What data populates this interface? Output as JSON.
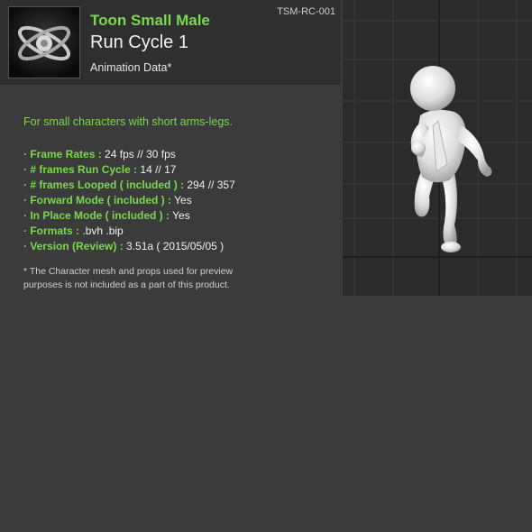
{
  "header": {
    "product_code": "TSM-RC-001",
    "title": "Toon Small Male",
    "subtitle": "Run Cycle 1",
    "data_label": "Animation Data*"
  },
  "description": "For small characters with short arms-legs.",
  "specs": [
    {
      "key": "· Frame Rates :",
      "value": "24 fps // 30 fps"
    },
    {
      "key": "· # frames Run Cycle :",
      "value": "14  // 17"
    },
    {
      "key": "· # frames Looped ( included ) :",
      "value": "294 // 357"
    },
    {
      "key": "· Forward Mode ( included ) :",
      "value": "Yes"
    },
    {
      "key": "· In Place Mode ( included ) :",
      "value": "Yes"
    },
    {
      "key": "· Formats :",
      "value": ".bvh  .bip"
    },
    {
      "key": "· Version (Review) :",
      "value": "3.51a ( 2015/05/05 )"
    }
  ],
  "note_line1": "* The Character mesh and props used for preview",
  "note_line2": "purposes is not included as a part of this product.",
  "colors": {
    "accent": "#7bd84e",
    "background": "#3b3b3b",
    "header": "#2f2f2f",
    "viewport": "#2b2b2b"
  },
  "icons": {
    "logo": "atom-orbit-logo",
    "preview": "toon-character-running-figure"
  }
}
